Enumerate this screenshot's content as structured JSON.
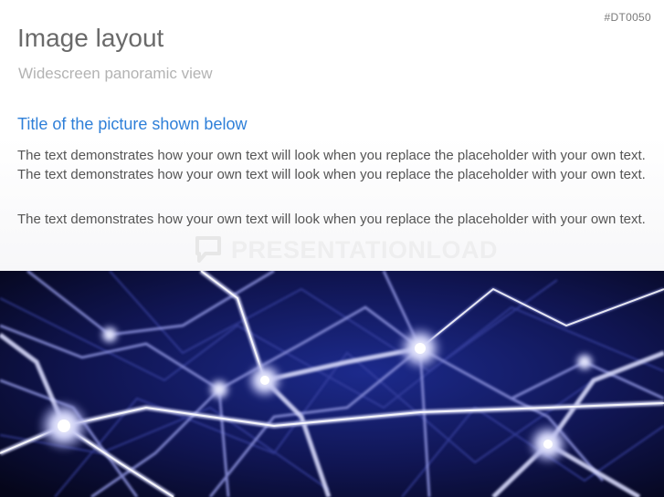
{
  "slide": {
    "code": "#DT0050",
    "title": "Image layout",
    "subtitle": "Widescreen panoramic view",
    "content_title": "Title of the picture shown below",
    "paragraphs": [
      "The text demonstrates how your own text will look when you replace the placeholder with your own text. The text demonstrates how your own text will look when you replace the placeholder with your own text.",
      "The text demonstrates how your own text will look when you replace the placeholder with your own text."
    ],
    "watermark": "PRESENTATIONLOAD",
    "watermark_icon": "speech-bubble-logo-icon",
    "image": {
      "subject": "neurons-network",
      "colors": {
        "background": "#0b0c2e",
        "fibers": "#b9bdf0",
        "highlight": "#eef0ff",
        "deep": "#1c2a8c"
      }
    },
    "colors": {
      "title": "#6a6a6a",
      "subtitle": "#b3b3b3",
      "accent": "#2e7fd8",
      "body": "#555555"
    }
  }
}
